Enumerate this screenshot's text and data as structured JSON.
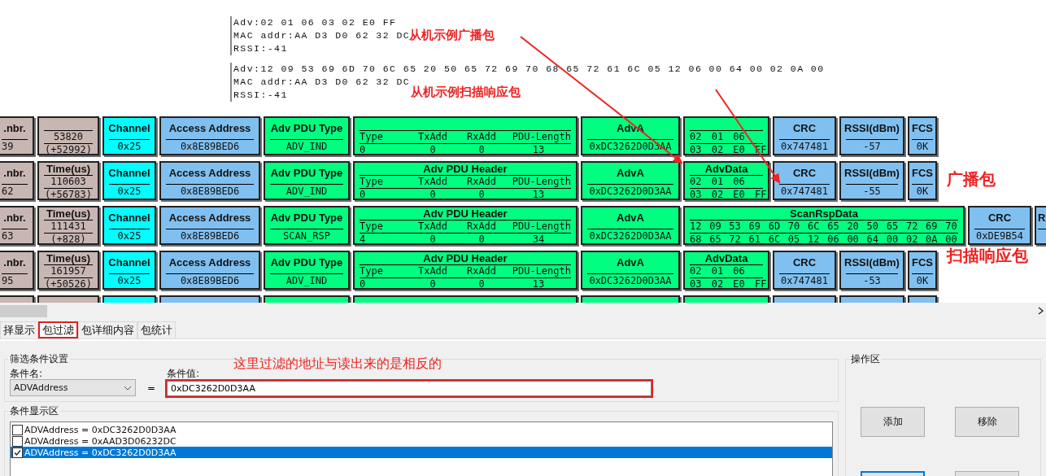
{
  "log_entries": [
    {
      "lines": [
        "Adv:02 01 06 03 02 E0 FF",
        "MAC addr:AA D3 D0 62 32 DC",
        "RSSI:-41"
      ]
    },
    {
      "lines": [
        "Adv:12 09 53 69 6D 70 6C 65 20 50 65 72 69 70 68 65 72 61 6C 05 12 06 00 64 00 02 0A 00",
        "MAC addr:AA D3 D0 62 32 DC",
        "RSSI:-41"
      ]
    }
  ],
  "annotations": [
    "从机示例广播包",
    "从机示例扫描响应包",
    "广播包",
    "扫描响应包",
    "这里过滤的地址与读出来的是相反的"
  ],
  "packets": [
    {
      "cells": [
        {
          "kind": "pnbr",
          "color": "#c8b6b2",
          "title": ".nbr.",
          "value": "39"
        },
        {
          "kind": "time",
          "color": "#c8b6b2",
          "value": "53820",
          "delta": "(+52992)"
        },
        {
          "kind": "channel",
          "color": "#00ffff",
          "title": "Channel",
          "value": "0x25"
        },
        {
          "kind": "address",
          "color": "#80c0f0",
          "title": "Access Address",
          "value": "0x8E89BED6"
        },
        {
          "kind": "pdu_type",
          "color": "#00ff80",
          "title": "Adv PDU Type",
          "value": "ADV_IND"
        },
        {
          "kind": "pdu_header",
          "color": "#00ff80",
          "labels": [
            "Type",
            "TxAdd",
            "RxAdd",
            "PDU-Length"
          ],
          "values": [
            "0",
            "0",
            "0",
            "13"
          ]
        },
        {
          "kind": "adv_addr",
          "color": "#00ff80",
          "title": "AdvA",
          "value": "0xDC3262D0D3AA"
        },
        {
          "kind": "adv_data",
          "color": "#00ff80",
          "lines": [
            "02 01 06",
            "03 02 E0 FF"
          ]
        },
        {
          "kind": "crc",
          "color": "#80c0f0",
          "title": "CRC",
          "value": "0x747481"
        },
        {
          "kind": "rssi",
          "color": "#80c0f0",
          "title": "RSSI(dBm)",
          "value": "-57"
        },
        {
          "kind": "fcs",
          "color": "#80c0f0",
          "title": "FCS",
          "value": "0K"
        }
      ]
    },
    {
      "cells": [
        {
          "kind": "pnbr",
          "color": "#c8b6b2",
          "title": ".nbr.",
          "value": "62"
        },
        {
          "kind": "time",
          "color": "#c8b6b2",
          "title": "Time(us)",
          "value": "110603",
          "delta": "(+56783)"
        },
        {
          "kind": "channel",
          "color": "#00ffff",
          "title": "Channel",
          "value": "0x25"
        },
        {
          "kind": "address",
          "color": "#80c0f0",
          "title": "Access Address",
          "value": "0x8E89BED6"
        },
        {
          "kind": "pdu_type",
          "color": "#00ff80",
          "title": "Adv PDU Type",
          "value": "ADV_IND"
        },
        {
          "kind": "pdu_header",
          "color": "#00ff80",
          "title": "Adv PDU Header",
          "labels": [
            "Type",
            "TxAdd",
            "RxAdd",
            "PDU-Length"
          ],
          "values": [
            "0",
            "0",
            "0",
            "13"
          ]
        },
        {
          "kind": "adv_addr",
          "color": "#00ff80",
          "title": "AdvA",
          "value": "0xDC3262D0D3AA"
        },
        {
          "kind": "adv_data",
          "color": "#00ff80",
          "title": "AdvData",
          "lines": [
            "02 01 06",
            "03 02 E0 FF"
          ]
        },
        {
          "kind": "crc",
          "color": "#80c0f0",
          "title": "CRC",
          "value": "0x747481"
        },
        {
          "kind": "rssi",
          "color": "#80c0f0",
          "title": "RSSI(dBm)",
          "value": "-55"
        },
        {
          "kind": "fcs",
          "color": "#80c0f0",
          "title": "FCS",
          "value": "0K"
        }
      ]
    },
    {
      "cells": [
        {
          "kind": "pnbr",
          "color": "#c8b6b2",
          "title": ".nbr.",
          "value": "63"
        },
        {
          "kind": "time",
          "color": "#c8b6b2",
          "title": "Time(us)",
          "value": "111431",
          "delta": "(+828)"
        },
        {
          "kind": "channel",
          "color": "#00ffff",
          "title": "Channel",
          "value": "0x25"
        },
        {
          "kind": "address",
          "color": "#80c0f0",
          "title": "Access Address",
          "value": "0x8E89BED6"
        },
        {
          "kind": "pdu_type",
          "color": "#00ff80",
          "title": "Adv PDU Type",
          "value": "SCAN_RSP"
        },
        {
          "kind": "pdu_header",
          "color": "#00ff80",
          "title": "Adv PDU Header",
          "labels": [
            "Type",
            "TxAdd",
            "RxAdd",
            "PDU-Length"
          ],
          "values": [
            "4",
            "0",
            "0",
            "34"
          ]
        },
        {
          "kind": "adv_addr",
          "color": "#00ff80",
          "title": "AdvA",
          "value": "0xDC3262D0D3AA"
        },
        {
          "kind": "scan_data",
          "color": "#00ff80",
          "title": "ScanRspData",
          "lines": [
            "12 09 53 69 6D 70 6C 65 20 50 65 72 69 70",
            "68 65 72 61 6C 05 12 06 00 64 00 02 0A 00"
          ]
        },
        {
          "kind": "crc",
          "color": "#80c0f0",
          "title": "CRC",
          "value": "0xDE9B54"
        },
        {
          "kind": "cut",
          "color": "#80c0f0",
          "title": "R"
        }
      ]
    },
    {
      "cells": [
        {
          "kind": "pnbr",
          "color": "#c8b6b2",
          "title": ".nbr.",
          "value": "95"
        },
        {
          "kind": "time",
          "color": "#c8b6b2",
          "title": "Time(us)",
          "value": "161957",
          "delta": "(+50526)"
        },
        {
          "kind": "channel",
          "color": "#00ffff",
          "title": "Channel",
          "value": "0x25"
        },
        {
          "kind": "address",
          "color": "#80c0f0",
          "title": "Access Address",
          "value": "0x8E89BED6"
        },
        {
          "kind": "pdu_type",
          "color": "#00ff80",
          "title": "Adv PDU Type",
          "value": "ADV_IND"
        },
        {
          "kind": "pdu_header",
          "color": "#00ff80",
          "title": "Adv PDU Header",
          "labels": [
            "Type",
            "TxAdd",
            "RxAdd",
            "PDU-Length"
          ],
          "values": [
            "0",
            "0",
            "0",
            "13"
          ]
        },
        {
          "kind": "adv_addr",
          "color": "#00ff80",
          "title": "AdvA",
          "value": "0xDC3262D0D3AA"
        },
        {
          "kind": "adv_data",
          "color": "#00ff80",
          "title": "AdvData",
          "lines": [
            "02 01 06",
            "03 02 E0 FF"
          ]
        },
        {
          "kind": "crc",
          "color": "#80c0f0",
          "title": "CRC",
          "value": "0x747481"
        },
        {
          "kind": "rssi",
          "color": "#80c0f0",
          "title": "RSSI(dBm)",
          "value": "-53"
        },
        {
          "kind": "fcs",
          "color": "#80c0f0",
          "title": "FCS",
          "value": "0K"
        }
      ]
    },
    {
      "cells": [
        {
          "kind": "pnbr",
          "color": "#c8b6b2"
        },
        {
          "kind": "time",
          "color": "#c8b6b2"
        },
        {
          "kind": "channel",
          "color": "#00ffff"
        },
        {
          "kind": "address",
          "color": "#80c0f0"
        },
        {
          "kind": "pdu_type",
          "color": "#00ff80"
        },
        {
          "kind": "pdu_header",
          "color": "#00ff80"
        },
        {
          "kind": "adv_addr",
          "color": "#00ff80"
        },
        {
          "kind": "adv_data",
          "color": "#00ff80"
        },
        {
          "kind": "crc",
          "color": "#80c0f0"
        },
        {
          "kind": "rssi",
          "color": "#80c0f0"
        },
        {
          "kind": "fcs",
          "color": "#80c0f0"
        }
      ]
    }
  ],
  "tabs": [
    {
      "label": "择显示",
      "selected": false
    },
    {
      "label": "包过滤",
      "selected": true
    },
    {
      "label": "包详细内容",
      "selected": false
    },
    {
      "label": "包统计",
      "selected": false
    }
  ],
  "filter": {
    "group_title": "筛选条件设置",
    "name_label": "条件名:",
    "name_value": "ADVAddress",
    "operator": "=",
    "value_label": "条件值:",
    "value": "0xDC3262D0D3AA",
    "value_highlighted": true
  },
  "conditions": {
    "group_title": "条件显示区",
    "items": [
      {
        "text": "ADVAddress = 0xDC3262D0D3AA",
        "checked": false,
        "selected": false
      },
      {
        "text": "ADVAddress = 0xAAD3D06232DC",
        "checked": false,
        "selected": false
      },
      {
        "text": "ADVAddress = 0xDC3262D0D3AA",
        "checked": true,
        "selected": true
      }
    ]
  },
  "actions": {
    "group_title": "操作区",
    "buttons": [
      "添加",
      "移除"
    ]
  }
}
